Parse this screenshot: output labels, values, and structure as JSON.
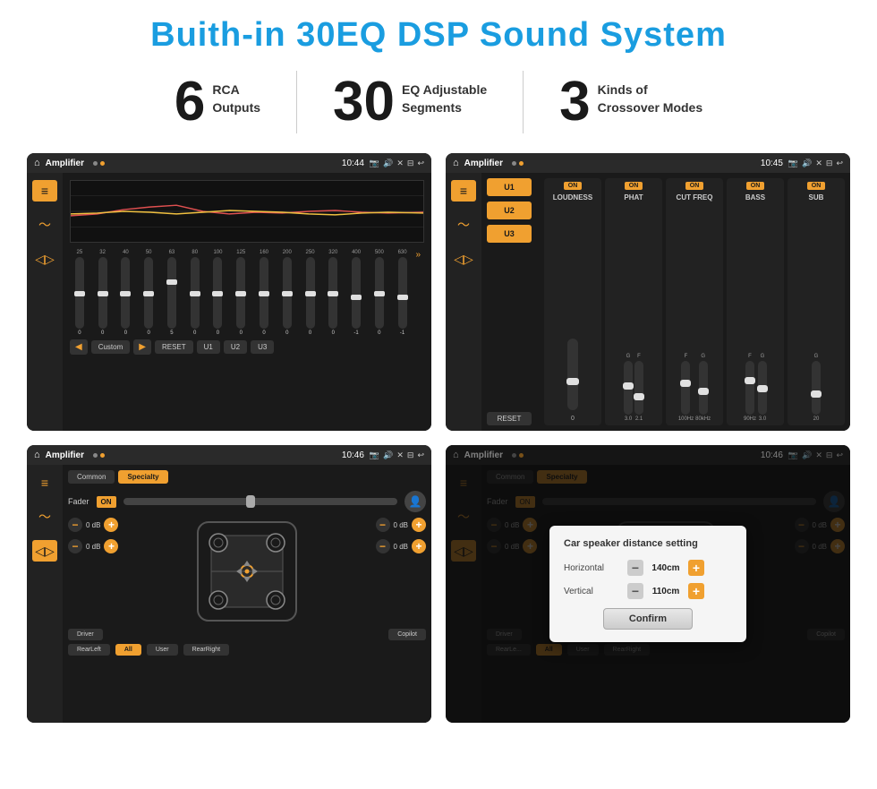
{
  "title": "Buith-in 30EQ DSP Sound System",
  "stats": [
    {
      "number": "6",
      "line1": "RCA",
      "line2": "Outputs"
    },
    {
      "number": "30",
      "line1": "EQ Adjustable",
      "line2": "Segments"
    },
    {
      "number": "3",
      "line1": "Kinds of",
      "line2": "Crossover Modes"
    }
  ],
  "screens": [
    {
      "id": "eq-screen",
      "status_bar": {
        "app": "Amplifier",
        "time": "10:44"
      },
      "type": "eq"
    },
    {
      "id": "crossover-screen",
      "status_bar": {
        "app": "Amplifier",
        "time": "10:45"
      },
      "type": "crossover"
    },
    {
      "id": "specialty-screen",
      "status_bar": {
        "app": "Amplifier",
        "time": "10:46"
      },
      "type": "specialty"
    },
    {
      "id": "distance-screen",
      "status_bar": {
        "app": "Amplifier",
        "time": "10:46"
      },
      "type": "distance",
      "dialog": {
        "title": "Car speaker distance setting",
        "horizontal_label": "Horizontal",
        "horizontal_value": "140cm",
        "vertical_label": "Vertical",
        "vertical_value": "110cm",
        "confirm_label": "Confirm"
      }
    }
  ],
  "eq": {
    "frequencies": [
      "25",
      "32",
      "40",
      "50",
      "63",
      "80",
      "100",
      "125",
      "160",
      "200",
      "250",
      "320",
      "400",
      "500",
      "630"
    ],
    "values": [
      "0",
      "0",
      "0",
      "0",
      "5",
      "0",
      "0",
      "0",
      "0",
      "0",
      "0",
      "0",
      "0",
      "-1",
      "0",
      "-1"
    ],
    "bottom_buttons": [
      "Custom",
      "RESET",
      "U1",
      "U2",
      "U3"
    ]
  },
  "crossover": {
    "presets": [
      "U1",
      "U2",
      "U3"
    ],
    "panels": [
      {
        "on": true,
        "label": "LOUDNESS"
      },
      {
        "on": true,
        "label": "PHAT"
      },
      {
        "on": true,
        "label": "CUT FREQ"
      },
      {
        "on": true,
        "label": "BASS"
      },
      {
        "on": true,
        "label": "SUB"
      }
    ],
    "reset_label": "RESET"
  },
  "specialty": {
    "tabs": [
      "Common",
      "Specialty"
    ],
    "fader_label": "Fader",
    "on_label": "ON",
    "db_controls": [
      {
        "value": "0 dB"
      },
      {
        "value": "0 dB"
      },
      {
        "value": "0 dB"
      },
      {
        "value": "0 dB"
      }
    ],
    "bottom_buttons": [
      "Driver",
      "",
      "Copilot",
      "RearLeft",
      "All",
      "User",
      "RearRight"
    ]
  },
  "distance_dialog": {
    "title": "Car speaker distance setting",
    "horizontal_label": "Horizontal",
    "horizontal_value": "140cm",
    "vertical_label": "Vertical",
    "vertical_value": "110cm",
    "confirm_label": "Confirm"
  }
}
